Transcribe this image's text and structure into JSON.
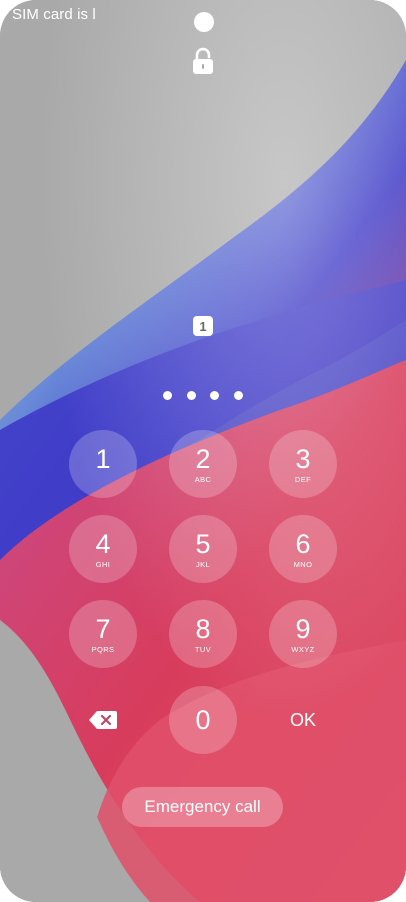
{
  "status": {
    "sim_text": "SIM card is l"
  },
  "sim_badge": {
    "number": "1"
  },
  "pin": {
    "entered_count": 4
  },
  "keypad": {
    "keys": [
      {
        "digit": "1",
        "letters": ""
      },
      {
        "digit": "2",
        "letters": "ABC"
      },
      {
        "digit": "3",
        "letters": "DEF"
      },
      {
        "digit": "4",
        "letters": "GHI"
      },
      {
        "digit": "5",
        "letters": "JKL"
      },
      {
        "digit": "6",
        "letters": "MNO"
      },
      {
        "digit": "7",
        "letters": "PQRS"
      },
      {
        "digit": "8",
        "letters": "TUV"
      },
      {
        "digit": "9",
        "letters": "WXYZ"
      },
      {
        "digit": "0",
        "letters": ""
      }
    ],
    "ok_label": "OK"
  },
  "emergency": {
    "label": "Emergency call"
  },
  "icons": {
    "lock": "lock-icon",
    "backspace": "backspace-icon",
    "sim": "sim-card-icon"
  },
  "colors": {
    "background_gray": "#a9a9a9",
    "wallpaper_blue": "#3a3ccf",
    "wallpaper_red": "#d84060",
    "foreground": "#ffffff"
  }
}
